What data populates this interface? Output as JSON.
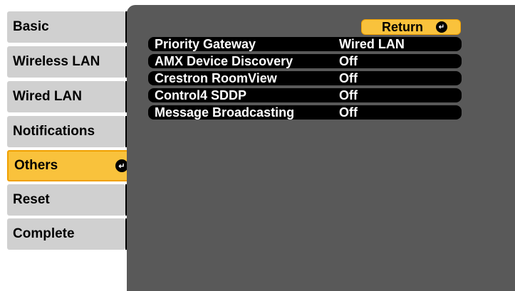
{
  "sidebar": {
    "items": [
      {
        "label": "Basic"
      },
      {
        "label": "Wireless LAN"
      },
      {
        "label": "Wired LAN"
      },
      {
        "label": "Notifications"
      },
      {
        "label": "Others",
        "selected": true
      },
      {
        "label": "Reset"
      },
      {
        "label": "Complete"
      }
    ]
  },
  "panel": {
    "return_label": "Return",
    "settings": [
      {
        "name": "Priority Gateway",
        "value": "Wired LAN"
      },
      {
        "name": "AMX Device Discovery",
        "value": "Off"
      },
      {
        "name": "Crestron RoomView",
        "value": "Off"
      },
      {
        "name": "Control4 SDDP",
        "value": "Off"
      },
      {
        "name": "Message Broadcasting",
        "value": "Off"
      }
    ]
  },
  "colors": {
    "selected": "#f9c23c",
    "item_bg": "#d0d0d0",
    "panel_bg": "#595959",
    "row_bg": "#000000"
  },
  "icons": {
    "enter": "enter-icon"
  }
}
